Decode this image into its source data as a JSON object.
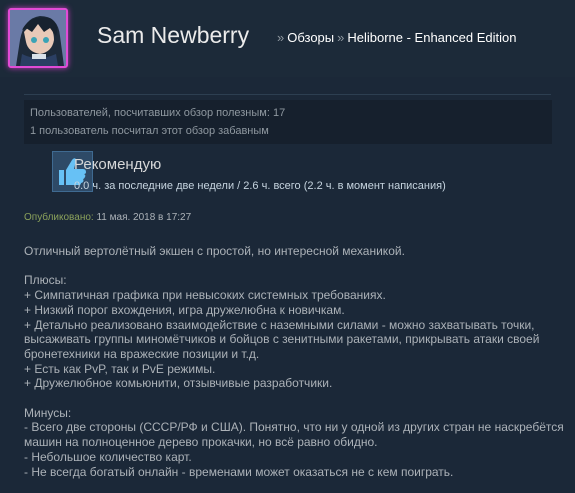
{
  "header": {
    "username": "Sam Newberry",
    "breadcrumbs": [
      {
        "label": "Обзоры"
      },
      {
        "label": "Heliborne - Enhanced Edition"
      }
    ],
    "separator": "»",
    "avatar_border_color": "#e24bd6"
  },
  "helpful": {
    "line1": "Пользователей, посчитавших обзор полезным: 17",
    "line2": "1 пользователь посчитал этот обзор забавным"
  },
  "recommendation": {
    "icon": "thumbs-up-icon",
    "label": "Рекомендую",
    "hours": "0.0 ч. за последние две недели / 2.6 ч. всего (2.2 ч. в момент написания)"
  },
  "posted": {
    "prefix": "Опубликовано:",
    "date": "11 мая. 2018 в 17:27"
  },
  "review": {
    "intro": "Отличный вертолётный экшен с простой, но интересной механикой.",
    "pros_title": "Плюсы:",
    "pros": [
      "+ Симпатичная графика при невысоких системных требованиях.",
      "+ Низкий порог вхождения, игра дружелюбна к новичкам.",
      "+ Детально реализовано взаимодействие с наземными силами - можно захватывать точки, высаживать группы миномётчиков и бойцов с зенитными ракетами, прикрывать атаки своей бронетехники на вражеские позиции и т.д.",
      "+ Есть как PvP, так и PvE режимы.",
      "+ Дружелюбное комьюнити, отзывчивые разработчики."
    ],
    "cons_title": "Минусы:",
    "cons": [
      "- Всего две стороны (СССР/РФ и США). Понятно, что ни у одной из других стран не наскребётся машин на полноценное дерево прокачки, но всё равно обидно.",
      "- Небольшое количество карт.",
      "- Не всегда богатый онлайн - временами может оказаться не с кем поиграть."
    ]
  }
}
